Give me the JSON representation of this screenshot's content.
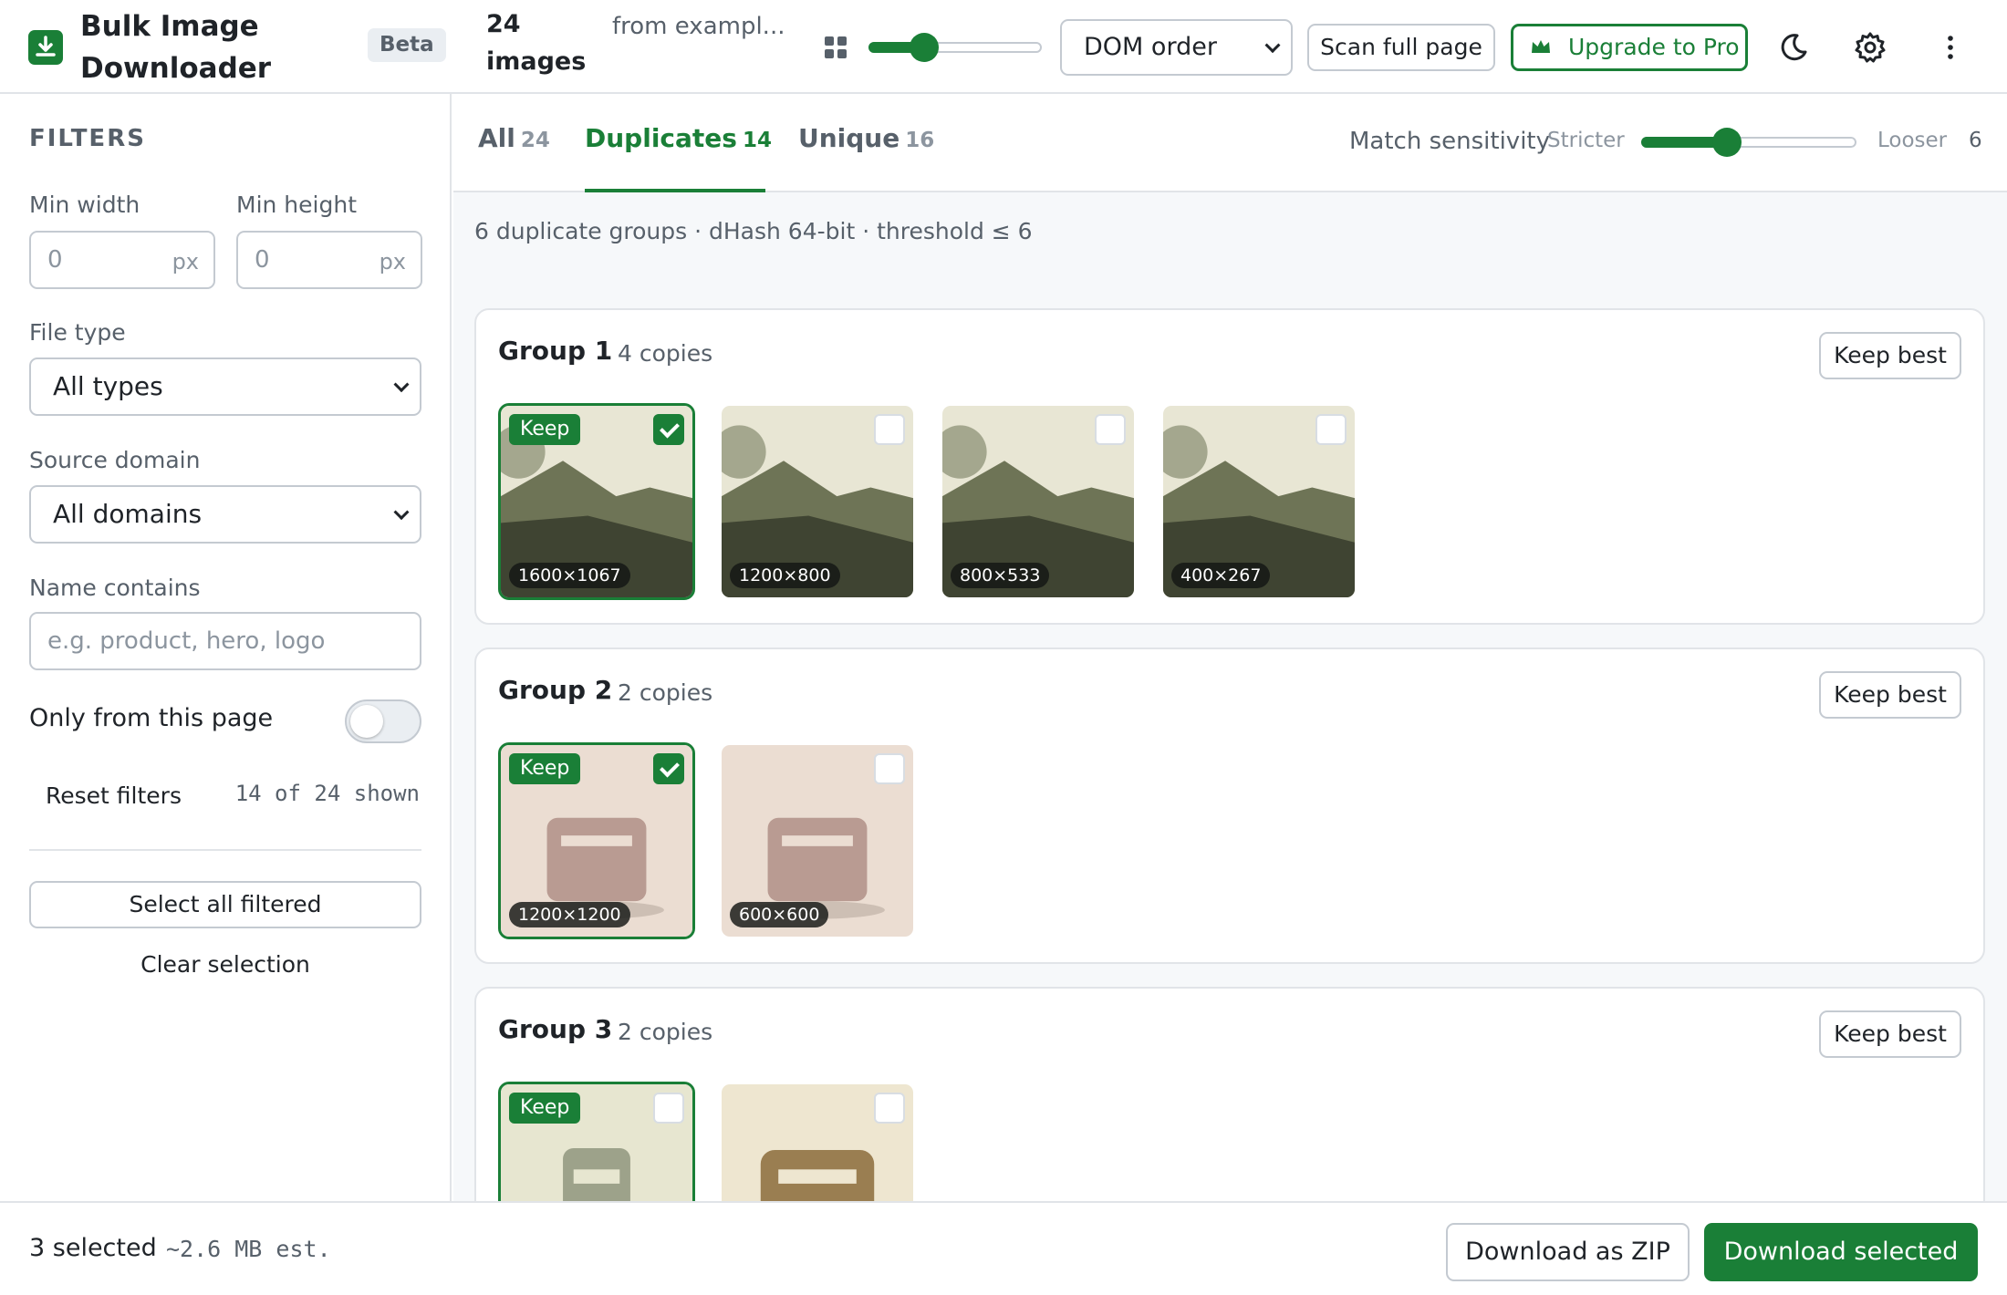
{
  "header": {
    "title": "Bulk Image Downloader",
    "badge": "Beta",
    "image_count": "24 images",
    "source": "from exampl...",
    "thumb_size_level": 0.32,
    "sort_value": "DOM order",
    "scan_label": "Scan full page",
    "upgrade_label": "Upgrade to Pro",
    "icons": [
      "download-icon",
      "grid-icon",
      "crown-icon",
      "moon-icon",
      "gear-icon",
      "kebab-icon"
    ]
  },
  "filters": {
    "heading": "FILTERS",
    "min_width_label": "Min width",
    "min_width_value": "0",
    "min_height_label": "Min height",
    "min_height_value": "0",
    "unit": "px",
    "file_type_label": "File type",
    "file_type_value": "All types",
    "source_domain_label": "Source domain",
    "source_domain_value": "All domains",
    "name_label": "Name contains",
    "name_placeholder": "e.g. product, hero, logo",
    "only_page_label": "Only from this page",
    "only_page_on": false,
    "reset_label": "Reset filters",
    "shown_text": "14 of 24 shown",
    "select_all_label": "Select all filtered",
    "clear_label": "Clear selection"
  },
  "tabs": [
    {
      "label": "All",
      "count": "24",
      "active": false
    },
    {
      "label": "Duplicates",
      "count": "14",
      "active": true
    },
    {
      "label": "Unique",
      "count": "16",
      "active": false
    }
  ],
  "sensitivity": {
    "label": "Match sensitivity",
    "min_label": "Stricter",
    "max_label": "Looser",
    "value": "6",
    "level": 0.4
  },
  "summary": "6 duplicate groups · dHash 64-bit · threshold ≤ 6",
  "keep_best_label": "Keep best",
  "keep_tag": "Keep",
  "groups": [
    {
      "title": "Group 1",
      "copies": "4 copies",
      "images": [
        {
          "dims": "1600×1067",
          "keep": true,
          "checked": true,
          "art": "landscape"
        },
        {
          "dims": "1200×800",
          "keep": false,
          "checked": false,
          "art": "landscape"
        },
        {
          "dims": "800×533",
          "keep": false,
          "checked": false,
          "art": "landscape"
        },
        {
          "dims": "400×267",
          "keep": false,
          "checked": false,
          "art": "landscape"
        }
      ]
    },
    {
      "title": "Group 2",
      "copies": "2 copies",
      "images": [
        {
          "dims": "1200×1200",
          "keep": true,
          "checked": true,
          "art": "box"
        },
        {
          "dims": "600×600",
          "keep": false,
          "checked": false,
          "art": "box"
        }
      ]
    },
    {
      "title": "Group 3",
      "copies": "2 copies",
      "images": [
        {
          "dims": "",
          "keep": true,
          "checked": false,
          "art": "bottle"
        },
        {
          "dims": "",
          "keep": false,
          "checked": false,
          "art": "jar"
        }
      ]
    }
  ],
  "footer": {
    "selected": "3 selected",
    "size": "~2.6 MB est.",
    "zip_label": "Download as ZIP",
    "download_label": "Download selected"
  },
  "colors": {
    "accent": "#1a7f37",
    "muted": "#57606a",
    "border": "#c4cad1"
  }
}
